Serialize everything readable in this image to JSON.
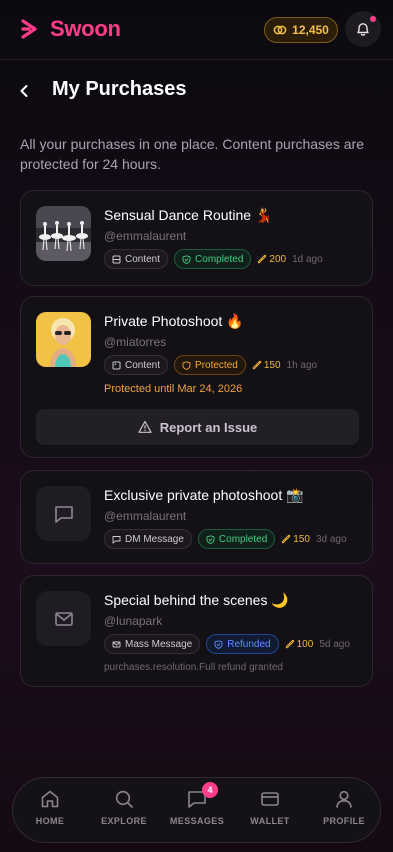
{
  "app": {
    "name": "Swoon",
    "coins": "12,450",
    "accent": "#ff3d8b",
    "gold": "#f4c04a"
  },
  "page": {
    "title": "My Purchases",
    "intro": "All your purchases in one place. Content purchases are protected for 24 hours."
  },
  "purchases": [
    {
      "title": "Sensual Dance Routine 💃",
      "user": "@emmalaurent",
      "type": "Content",
      "status": "Completed",
      "price": "200",
      "ago": "1d ago",
      "thumb": "ballet-dancers-image"
    },
    {
      "title": "Private Photoshoot 🔥",
      "user": "@miatorres",
      "type": "Content",
      "status": "Protected",
      "price": "150",
      "ago": "1h ago",
      "note": "Protected until Mar 24, 2026",
      "action": "Report an Issue",
      "thumb": "woman-sunglasses-image"
    },
    {
      "title": "Exclusive private photoshoot 📸",
      "user": "@emmalaurent",
      "type": "DM Message",
      "status": "Completed",
      "price": "150",
      "ago": "3d ago",
      "icon": "chat-bubble-icon"
    },
    {
      "title": "Special behind the scenes 🌙",
      "user": "@lunapark",
      "type": "Mass Message",
      "status": "Refunded",
      "price": "100",
      "ago": "5d ago",
      "resolution": "purchases.resolution.Full refund granted",
      "icon": "mail-icon"
    }
  ],
  "nav": {
    "items": [
      {
        "label": "HOME",
        "icon": "home-icon"
      },
      {
        "label": "EXPLORE",
        "icon": "search-icon"
      },
      {
        "label": "MESSAGES",
        "icon": "message-icon",
        "badge": "4"
      },
      {
        "label": "WALLET",
        "icon": "wallet-icon"
      },
      {
        "label": "PROFILE",
        "icon": "profile-icon"
      }
    ]
  }
}
